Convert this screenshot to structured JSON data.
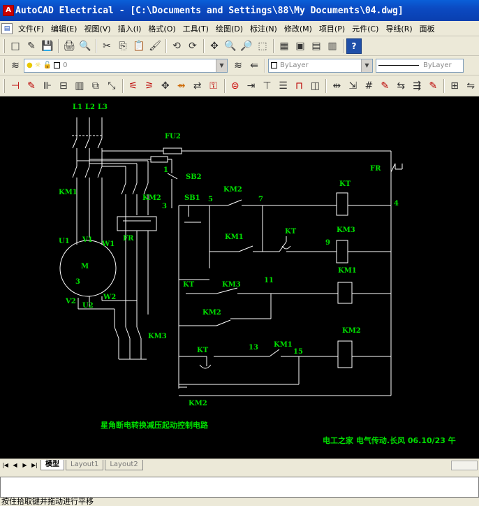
{
  "window": {
    "app_icon": "A",
    "title": "AutoCAD Electrical - [C:\\Documents and Settings\\88\\My Documents\\04.dwg]"
  },
  "menu": {
    "mdi_icon": "doc",
    "items": [
      "文件(F)",
      "编辑(E)",
      "视图(V)",
      "插入(I)",
      "格式(O)",
      "工具(T)",
      "绘图(D)",
      "标注(N)",
      "修改(M)",
      "项目(P)",
      "元件(C)",
      "导线(R)",
      "面板"
    ]
  },
  "toolbar": {
    "standard": [
      "□",
      "✎",
      "💾",
      "🖨",
      "🔍",
      "✂",
      "⎘",
      "📋",
      "🖌",
      "⟲",
      "⟳",
      "✥",
      "🔍",
      "🔎",
      "⬚",
      "▦",
      "▣",
      "▤",
      "▥",
      "?"
    ],
    "layer_value": "0",
    "color_value": "ByLayer",
    "linetype_value": "ByLayer"
  },
  "drawing": {
    "labels": {
      "l1": "L1",
      "l2": "L2",
      "l3": "L3",
      "fu2": "FU2",
      "fr_top": "FR",
      "km1_left": "KM1",
      "km2_left": "KM2",
      "n1": "1",
      "sb2": "SB2",
      "n3": "3",
      "sb1": "SB1",
      "n5": "5",
      "km2_c": "KM2",
      "n7": "7",
      "kt_coil": "KT",
      "n4": "4",
      "km1_c": "KM1",
      "kt_c": "KT",
      "km3_coil": "KM3",
      "n9": "9",
      "u1": "U1",
      "v1": "V1",
      "w1": "W1",
      "fr_mid": "FR",
      "m": "M",
      "m3": "3",
      "km1_coil": "KM1",
      "kt_b": "KT",
      "km3_c": "KM3",
      "n11": "11",
      "v2": "V2",
      "u2": "U2",
      "w2": "W2",
      "km2_b": "KM2",
      "km3_left": "KM3",
      "km2_coil": "KM2",
      "kt_d": "KT",
      "n13": "13",
      "km1_d": "KM1",
      "n15": "15",
      "km2_e": "KM2",
      "caption": "星角断电转换减压起动控制电路",
      "footer": "电工之家  电气传动.长风  06.10/23 午"
    }
  },
  "tabs": {
    "nav": [
      "|◀",
      "◀",
      "▶",
      "▶|"
    ],
    "items": [
      "模型",
      "Layout1",
      "Layout2"
    ]
  },
  "status": {
    "text": "按住拾取键并拖动进行平移"
  }
}
